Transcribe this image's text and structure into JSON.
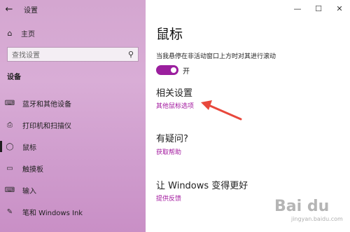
{
  "window": {
    "title": "设置",
    "controls": {
      "minimize": "—",
      "maximize": "☐",
      "close": "✕"
    }
  },
  "sidebar": {
    "back_glyph": "←",
    "home_label": "主页",
    "home_icon": "home-icon",
    "search": {
      "placeholder": "查找设置",
      "icon": "search-icon"
    },
    "section": "设备",
    "items": [
      {
        "label": "蓝牙和其他设备",
        "icon": "bluetooth-devices-icon"
      },
      {
        "label": "打印机和扫描仪",
        "icon": "printer-icon"
      },
      {
        "label": "鼠标",
        "icon": "mouse-icon",
        "active": true
      },
      {
        "label": "触摸板",
        "icon": "touchpad-icon"
      },
      {
        "label": "输入",
        "icon": "keyboard-icon"
      },
      {
        "label": "笔和 Windows Ink",
        "icon": "pen-icon"
      }
    ]
  },
  "main": {
    "title": "鼠标",
    "scroll_inactive_label": "当我悬停在非活动窗口上方时对其进行滚动",
    "scroll_inactive_state": "开",
    "related": {
      "heading": "相关设置",
      "link": "其他鼠标选项"
    },
    "question": {
      "heading": "有疑问?",
      "link": "获取帮助"
    },
    "improve": {
      "heading": "让 Windows 变得更好",
      "link": "提供反馈"
    }
  },
  "accent_colors": {
    "toggle_on": "#9b1f9e",
    "link": "#a2179e",
    "arrow": "#e8483c"
  },
  "watermark": {
    "brand": "Bai du",
    "sub": "jingyan.baidu.com"
  }
}
